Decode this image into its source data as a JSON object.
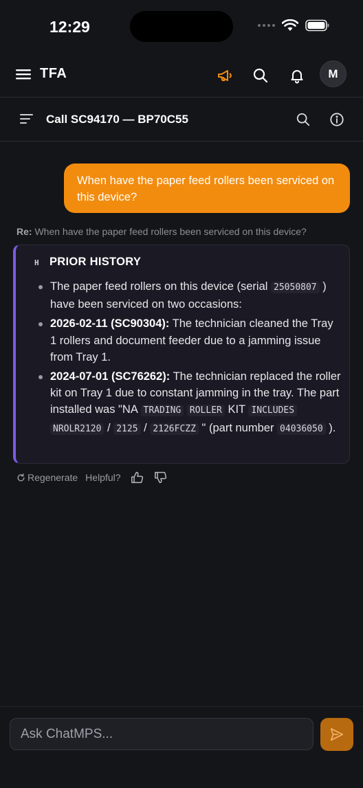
{
  "status": {
    "time": "12:29"
  },
  "header": {
    "brand": "TFA",
    "avatar_initial": "M"
  },
  "call": {
    "title": "Call SC94170 — BP70C55"
  },
  "chat": {
    "user_message": "When have the paper feed rollers been serviced on this device?",
    "re_prefix": "Re:",
    "re_text": "When have the paper feed rollers been serviced on this device?"
  },
  "answer": {
    "badge": "H",
    "heading": "PRIOR HISTORY",
    "intro_before": "The paper feed rollers on this device (serial",
    "serial": "25050807",
    "intro_after": ") have been serviced on two occasions:",
    "item1_date": "2026-02-11 (SC90304):",
    "item1_text": "The technician cleaned the Tray 1 rollers and document feeder due to a jamming issue from Tray 1.",
    "item2_date": "2024-07-01 (SC76262):",
    "item2_text": "The technician replaced the roller kit on Tray 1 due to constant jamming in the tray. The part installed was \"NA",
    "item2_code1": "TRADING",
    "item2_code2": "ROLLER",
    "item2_kit": "KIT",
    "item2_code3": "INCLUDES",
    "item2_code4": "NROLR2120",
    "slash1": "/",
    "item2_code5": "2125",
    "slash2": "/",
    "item2_code6": "2126FCZZ",
    "item2_part_prefix": "\" (part number",
    "item2_part": "04036050",
    "item2_end": ")."
  },
  "actions": {
    "regenerate": "Regenerate",
    "helpful": "Helpful?"
  },
  "composer": {
    "placeholder": "Ask ChatMPS..."
  },
  "colors": {
    "accent": "#f28c0f",
    "card_border": "#7b5be6",
    "background": "#141519"
  }
}
